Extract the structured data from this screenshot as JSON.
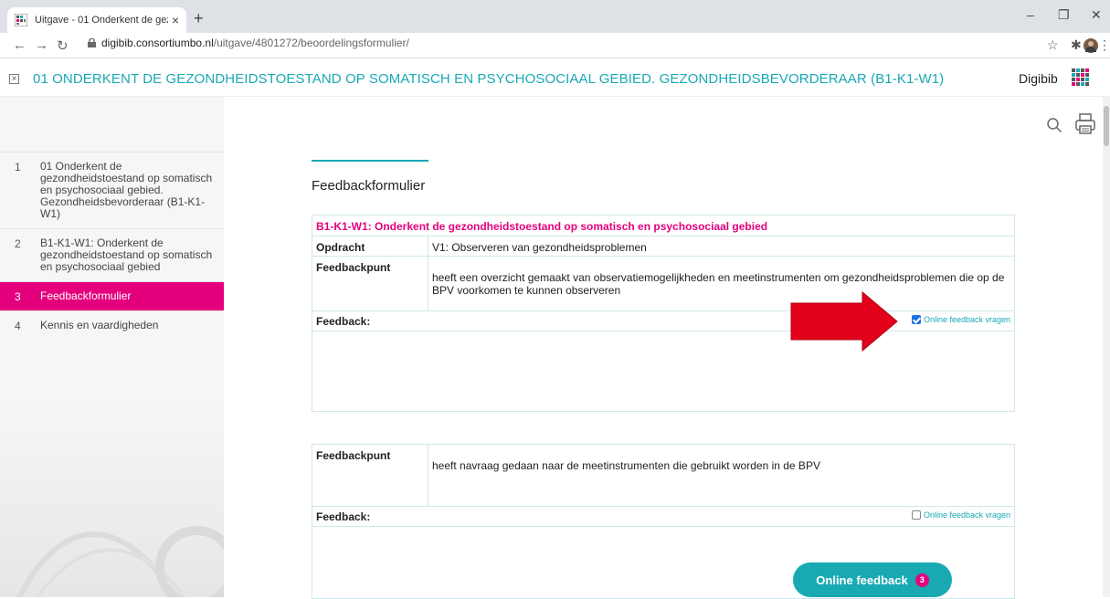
{
  "browser": {
    "tab_title": "Uitgave - 01 Onderkent de gezor",
    "url_host": "digibib.consortiumbo.nl",
    "url_path": "/uitgave/4801272/beoordelingsformulier/"
  },
  "header": {
    "close_glyph": "×",
    "title": "01 ONDERKENT DE GEZONDHEIDSTOESTAND OP SOMATISCH EN PSYCHOSOCIAAL GEBIED. GEZONDHEIDSBEVORDERAAR (B1-K1-W1)",
    "brand": "Digibib"
  },
  "sidebar": {
    "items": [
      {
        "num": "1",
        "label": "01 Onderkent de gezondheidstoestand op somatisch en psychosociaal gebied. Gezondheidsbevorderaar (B1-K1-W1)"
      },
      {
        "num": "2",
        "label": "B1-K1-W1: Onderkent de gezondheidstoestand op somatisch en psychosociaal gebied"
      },
      {
        "num": "3",
        "label": "Feedbackformulier"
      },
      {
        "num": "4",
        "label": "Kennis en vaardigheden"
      }
    ],
    "active_index": 2
  },
  "content": {
    "page_title": "Feedbackformulier",
    "section_heading": "B1-K1-W1: Onderkent de gezondheidstoestand op somatisch en psychosociaal gebied",
    "opdracht_label": "Opdracht",
    "opdracht_value": "V1: Observeren van gezondheidsproblemen",
    "feedbackpunt_label": "Feedbackpunt",
    "feedbackpunt_1": "heeft een overzicht gemaakt van observatiemogelijkheden en meetinstrumenten om gezondheidsproblemen die op de BPV voorkomen te kunnen observeren",
    "feedbackpunt_2": "heeft navraag gedaan naar de meetinstrumenten die gebruikt worden in de BPV",
    "feedback_label": "Feedback:",
    "online_feedback_vragen": "Online feedback vragen",
    "checkbox_1_checked": true,
    "checkbox_2_checked": false
  },
  "online_feedback_button": {
    "label": "Online feedback",
    "count": "3"
  },
  "colors": {
    "teal": "#19a9b3",
    "magenta": "#e4007d",
    "arrow_red": "#e3001b"
  }
}
